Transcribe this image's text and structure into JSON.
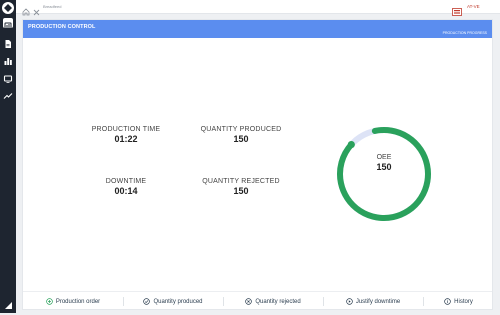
{
  "colors": {
    "sidebar": "#1e2530",
    "header": "#5b8def",
    "gauge_fill": "#2aa15c",
    "gauge_track": "#dde3f6",
    "user_accent": "#c0392b"
  },
  "sidebar": {
    "icons": [
      "logo-icon",
      "dashboard-icon",
      "document-icon",
      "bar-chart-icon",
      "monitor-icon",
      "trend-icon",
      "collapse-icon"
    ]
  },
  "topbar": {
    "breadcrumb": "Breadfeed",
    "user_label": "AT-VE"
  },
  "panel": {
    "title": "PRODUCTION CONTROL",
    "subtitle": "PRODUCTION PROGRESS"
  },
  "metrics": {
    "production_time": {
      "label": "PRODUCTION TIME",
      "value": "01:22"
    },
    "quantity_produced": {
      "label": "QUANTITY PRODUCED",
      "value": "150"
    },
    "downtime": {
      "label": "DOWNTIME",
      "value": "00:14"
    },
    "quantity_rejected": {
      "label": "QUANTITY REJECTED",
      "value": "150"
    }
  },
  "gauge": {
    "label": "OEE",
    "value": "150",
    "green_fraction": 0.9,
    "icon": "ring-gauge"
  },
  "footer": {
    "buttons": [
      {
        "label": "Production order",
        "icon": "plus-circle-icon"
      },
      {
        "label": "Quantity produced",
        "icon": "check-circle-icon"
      },
      {
        "label": "Quantity rejected",
        "icon": "x-circle-icon"
      },
      {
        "label": "Justify downtime",
        "icon": "play-circle-icon"
      },
      {
        "label": "History",
        "icon": "info-circle-icon"
      }
    ]
  }
}
